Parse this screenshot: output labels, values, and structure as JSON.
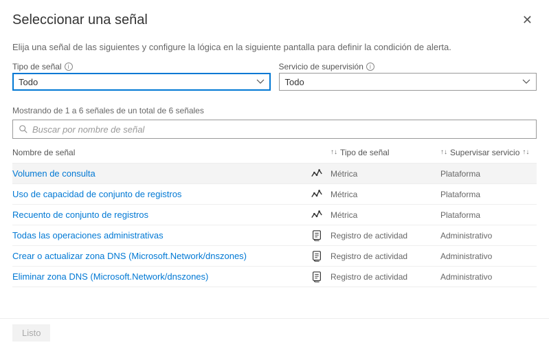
{
  "header": {
    "title": "Seleccionar una señal",
    "close": "✕"
  },
  "subtitle": "Elija una señal de las siguientes y configure la lógica en la siguiente pantalla para definir la condición de alerta.",
  "filters": {
    "signalType": {
      "label": "Tipo de señal",
      "value": "Todo"
    },
    "monitorService": {
      "label": "Servicio de supervisión",
      "value": "Todo"
    }
  },
  "countText": "Mostrando de 1 a 6 señales de un total de 6 señales",
  "search": {
    "placeholder": "Buscar por nombre de señal"
  },
  "columns": {
    "name": "Nombre de señal",
    "type": "Tipo de señal",
    "service": "Supervisar servicio",
    "sortGlyph": "↑↓"
  },
  "signals": [
    {
      "name": "Volumen de consulta",
      "iconKind": "metric",
      "type": "Métrica",
      "service": "Plataforma",
      "selected": true
    },
    {
      "name": "Uso de capacidad de conjunto de registros",
      "iconKind": "metric",
      "type": "Métrica",
      "service": "Plataforma",
      "selected": false
    },
    {
      "name": "Recuento de conjunto de registros",
      "iconKind": "metric",
      "type": "Métrica",
      "service": "Plataforma",
      "selected": false
    },
    {
      "name": "Todas las operaciones administrativas",
      "iconKind": "activity",
      "type": "Registro de actividad",
      "service": "Administrativo",
      "selected": false
    },
    {
      "name": "Crear o actualizar zona DNS (Microsoft.Network/dnszones)",
      "iconKind": "activity",
      "type": "Registro de actividad",
      "service": "Administrativo",
      "selected": false
    },
    {
      "name": "Eliminar zona DNS (Microsoft.Network/dnszones)",
      "iconKind": "activity",
      "type": "Registro de actividad",
      "service": "Administrativo",
      "selected": false
    }
  ],
  "footer": {
    "done": "Listo"
  }
}
